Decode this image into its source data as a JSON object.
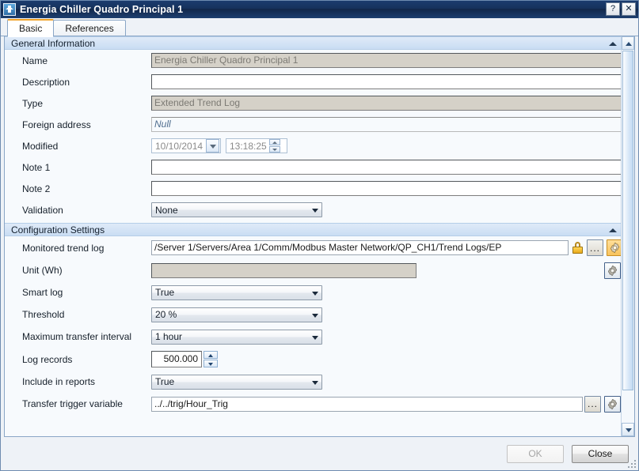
{
  "window": {
    "title": "Energia Chiller Quadro Principal 1",
    "icon": "application-icon",
    "help_label": "?",
    "close_label": "✕"
  },
  "tabs": [
    {
      "label": "Basic",
      "active": true
    },
    {
      "label": "References",
      "active": false
    }
  ],
  "sections": {
    "general": {
      "title": "General Information",
      "fields": {
        "name": {
          "label": "Name",
          "value": "Energia Chiller Quadro Principal 1",
          "disabled": true
        },
        "description": {
          "label": "Description",
          "value": "",
          "disabled": false
        },
        "type": {
          "label": "Type",
          "value": "Extended Trend Log",
          "disabled": true
        },
        "foreign_address": {
          "label": "Foreign address",
          "value": "Null",
          "disabled": false
        },
        "modified": {
          "label": "Modified",
          "date": "10/10/2014",
          "time": "13:18:25"
        },
        "note1": {
          "label": "Note 1",
          "value": ""
        },
        "note2": {
          "label": "Note 2",
          "value": ""
        },
        "validation": {
          "label": "Validation",
          "value": "None"
        }
      }
    },
    "configuration": {
      "title": "Configuration Settings",
      "fields": {
        "monitored_trend_log": {
          "label": "Monitored trend log",
          "value": "/Server 1/Servers/Area 1/Comm/Modbus Master Network/QP_CH1/Trend Logs/EP",
          "lock_icon": "lock-icon",
          "browse_label": "...",
          "gear_icon": "gear-icon"
        },
        "unit": {
          "label": "Unit (Wh)",
          "value": "",
          "disabled": true,
          "gear_icon": "gear-icon"
        },
        "smart_log": {
          "label": "Smart log",
          "value": "True"
        },
        "threshold": {
          "label": "Threshold",
          "value": "20 %"
        },
        "max_transfer_interval": {
          "label": "Maximum transfer interval",
          "value": "1 hour"
        },
        "log_records": {
          "label": "Log records",
          "value": "500.000"
        },
        "include_in_reports": {
          "label": "Include in reports",
          "value": "True"
        },
        "transfer_trigger_variable": {
          "label": "Transfer trigger variable",
          "value": "../../trig/Hour_Trig",
          "browse_label": "...",
          "gear_icon": "gear-icon"
        }
      }
    }
  },
  "footer": {
    "ok_label": "OK",
    "ok_disabled": true,
    "close_label": "Close"
  },
  "colors": {
    "titlebar": "#16325c",
    "accent_tab": "#f0a32a",
    "section_header": "#c9ddf3",
    "accent_gear": "#f8c35c",
    "disabled_field": "#d5d1c8"
  }
}
